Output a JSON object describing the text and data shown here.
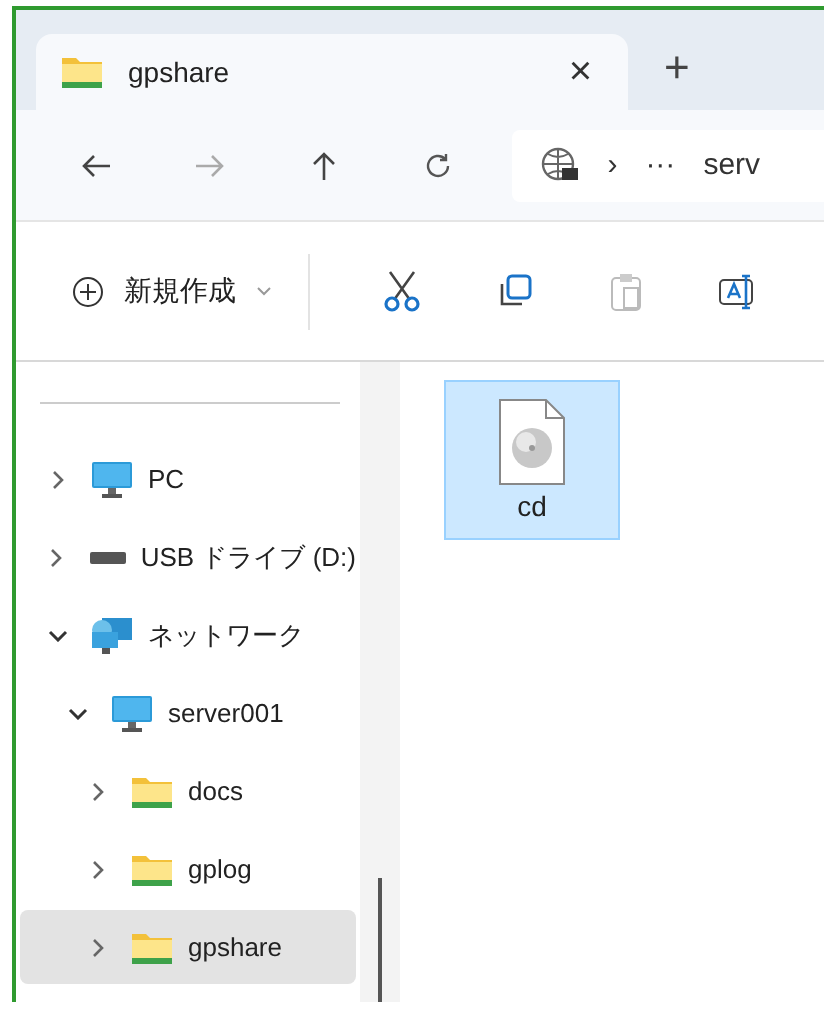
{
  "tabs": [
    {
      "label": "gpshare",
      "selected": true
    }
  ],
  "tab_close": "×",
  "new_tab": "+",
  "address": {
    "separator": "›",
    "overflow": "···",
    "path_visible": "serv"
  },
  "toolbar": {
    "new_label": "新規作成"
  },
  "sidebar": {
    "items": [
      {
        "label": "PC",
        "kind": "pc",
        "expanded": false,
        "selected": false
      },
      {
        "label": "USB ドライブ (D:)",
        "kind": "drive",
        "expanded": false,
        "selected": false
      },
      {
        "label": "ネットワーク",
        "kind": "network",
        "expanded": true,
        "selected": false,
        "children": [
          {
            "label": "server001",
            "kind": "pc",
            "expanded": true,
            "selected": false,
            "children": [
              {
                "label": "docs",
                "kind": "folder",
                "expanded": false,
                "selected": false
              },
              {
                "label": "gplog",
                "kind": "folder",
                "expanded": false,
                "selected": false
              },
              {
                "label": "gpshare",
                "kind": "folder",
                "expanded": false,
                "selected": true
              }
            ]
          }
        ]
      }
    ]
  },
  "files": [
    {
      "name": "cd",
      "kind": "disc-image",
      "selected": true
    }
  ]
}
